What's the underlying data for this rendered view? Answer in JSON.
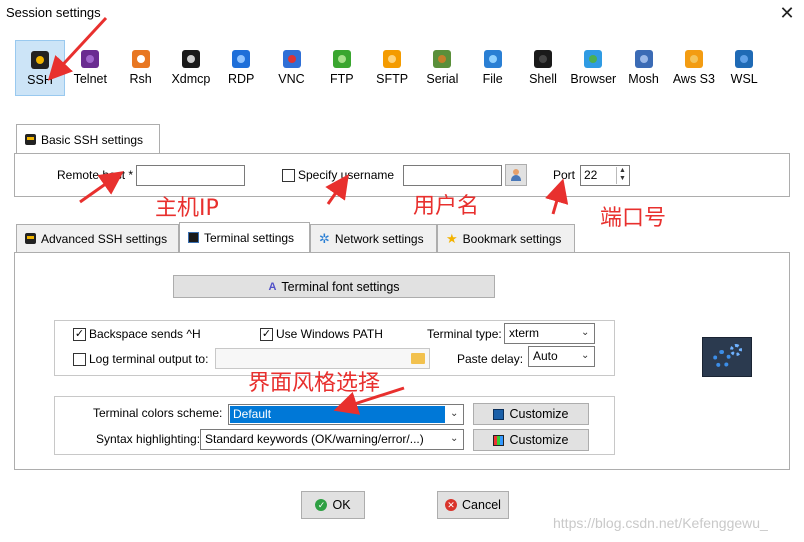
{
  "window": {
    "title": "Session settings"
  },
  "protocols": [
    {
      "label": "SSH",
      "color": "#222222",
      "accent": "#f0b400"
    },
    {
      "label": "Telnet",
      "color": "#6a2c91",
      "accent": "#a066cc"
    },
    {
      "label": "Rsh",
      "color": "#e87722",
      "accent": "#ffffff"
    },
    {
      "label": "Xdmcp",
      "color": "#1a1a1a",
      "accent": "#cccccc"
    },
    {
      "label": "RDP",
      "color": "#1e6fd9",
      "accent": "#8fc3ff"
    },
    {
      "label": "VNC",
      "color": "#2f6fd6",
      "accent": "#d33"
    },
    {
      "label": "FTP",
      "color": "#3aa62f",
      "accent": "#a6e08a"
    },
    {
      "label": "SFTP",
      "color": "#f49b00",
      "accent": "#ffd37a"
    },
    {
      "label": "Serial",
      "color": "#5a8f3a",
      "accent": "#c47f2a"
    },
    {
      "label": "File",
      "color": "#2a7fd4",
      "accent": "#8fd0ff"
    },
    {
      "label": "Shell",
      "color": "#1a1a1a",
      "accent": "#444444"
    },
    {
      "label": "Browser",
      "color": "#2f9be3",
      "accent": "#4caf50"
    },
    {
      "label": "Mosh",
      "color": "#3b6bb5",
      "accent": "#9ab8e8"
    },
    {
      "label": "Aws S3",
      "color": "#f39c12",
      "accent": "#f5c45a"
    },
    {
      "label": "WSL",
      "color": "#1f6ab5",
      "accent": "#5fa0e8"
    }
  ],
  "basic": {
    "tab_label": "Basic SSH settings",
    "remote_host_label": "Remote host *",
    "remote_host_value": "",
    "specify_username_label": "Specify username",
    "username_value": "",
    "port_label": "Port",
    "port_value": "22"
  },
  "tabs": [
    {
      "label": "Advanced SSH settings"
    },
    {
      "label": "Terminal settings"
    },
    {
      "label": "Network settings"
    },
    {
      "label": "Bookmark settings"
    }
  ],
  "terminal": {
    "font_button": "Terminal font settings",
    "backspace_label": "Backspace sends ^H",
    "backspace_checked": "✓",
    "windows_path_label": "Use Windows PATH",
    "windows_path_checked": "✓",
    "terminal_type_label": "Terminal type:",
    "terminal_type_value": "xterm",
    "log_output_label": "Log terminal output to:",
    "paste_delay_label": "Paste delay:",
    "paste_delay_value": "Auto",
    "colors_scheme_label": "Terminal colors scheme:",
    "colors_scheme_value": "Default",
    "syntax_label": "Syntax highlighting:",
    "syntax_value": "Standard keywords (OK/warning/error/...)",
    "customize_label": "Customize",
    "customize_label_2": "Customize"
  },
  "footer": {
    "ok_label": "OK",
    "cancel_label": "Cancel"
  },
  "annotations": {
    "host_ip": "主机IP",
    "username": "用户名",
    "port": "端口号",
    "scheme": "界面风格选择"
  },
  "watermark": "https://blog.csdn.net/Kefenggewu_",
  "colors": {
    "selection": "#0078d7",
    "annotation": "#e8302e",
    "ok_green": "#2ea043",
    "cancel_red": "#d9342b"
  }
}
